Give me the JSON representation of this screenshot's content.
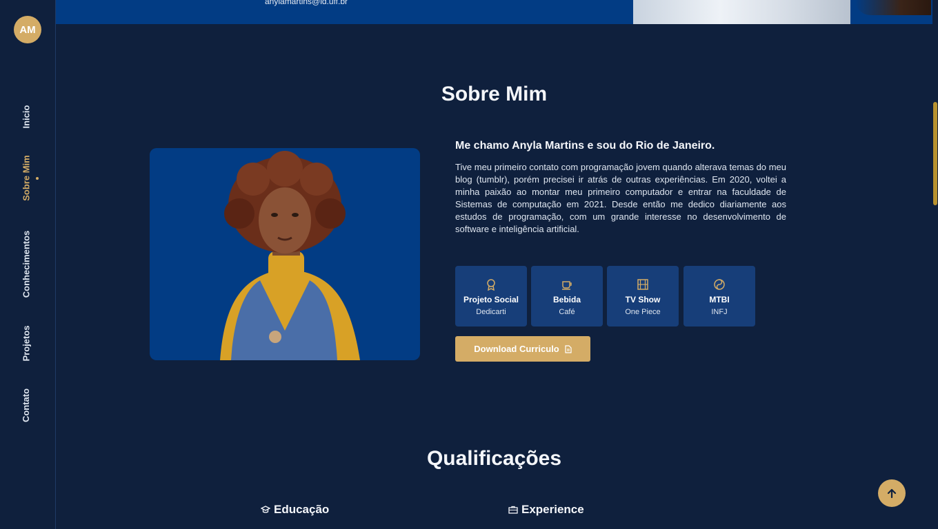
{
  "brand": {
    "initials": "AM"
  },
  "nav": {
    "items": [
      {
        "label": "Inicio"
      },
      {
        "label": "Sobre Mim"
      },
      {
        "label": "Conhecimentos"
      },
      {
        "label": "Projetos"
      },
      {
        "label": "Contato"
      }
    ],
    "active": "Sobre Mim"
  },
  "header": {
    "email": "anylamartins@id.uff.br"
  },
  "about": {
    "title": "Sobre Mim",
    "heading": "Me chamo Anyla Martins e sou do Rio de Janeiro.",
    "body": "Tive meu primeiro contato com programação jovem quando alterava temas do meu blog (tumblr), porém precisei ir atrás de outras experiências. Em 2020, voltei a minha paixão ao montar meu primeiro computador e entrar na faculdade de Sistemas de computação em 2021. Desde então me dedico diariamente aos estudos de programação, com um grande interesse no desenvolvimento de software e inteligência artificial.",
    "cards": [
      {
        "icon": "award-icon",
        "title": "Projeto Social",
        "value": "Dedicarti"
      },
      {
        "icon": "coffee-icon",
        "title": "Bebida",
        "value": "Café"
      },
      {
        "icon": "film-icon",
        "title": "TV Show",
        "value": "One Piece"
      },
      {
        "icon": "yin-yang-icon",
        "title": "MTBI",
        "value": "INFJ"
      }
    ],
    "download_label": "Download Curriculo"
  },
  "qualifications": {
    "title": "Qualificações",
    "tabs": [
      {
        "icon": "graduation-cap-icon",
        "label": "Educação"
      },
      {
        "icon": "briefcase-icon",
        "label": "Experience"
      }
    ]
  },
  "colors": {
    "background": "#0f203d",
    "accent": "#d4ac66",
    "card": "#173e79",
    "panel_blue": "#023c84"
  }
}
